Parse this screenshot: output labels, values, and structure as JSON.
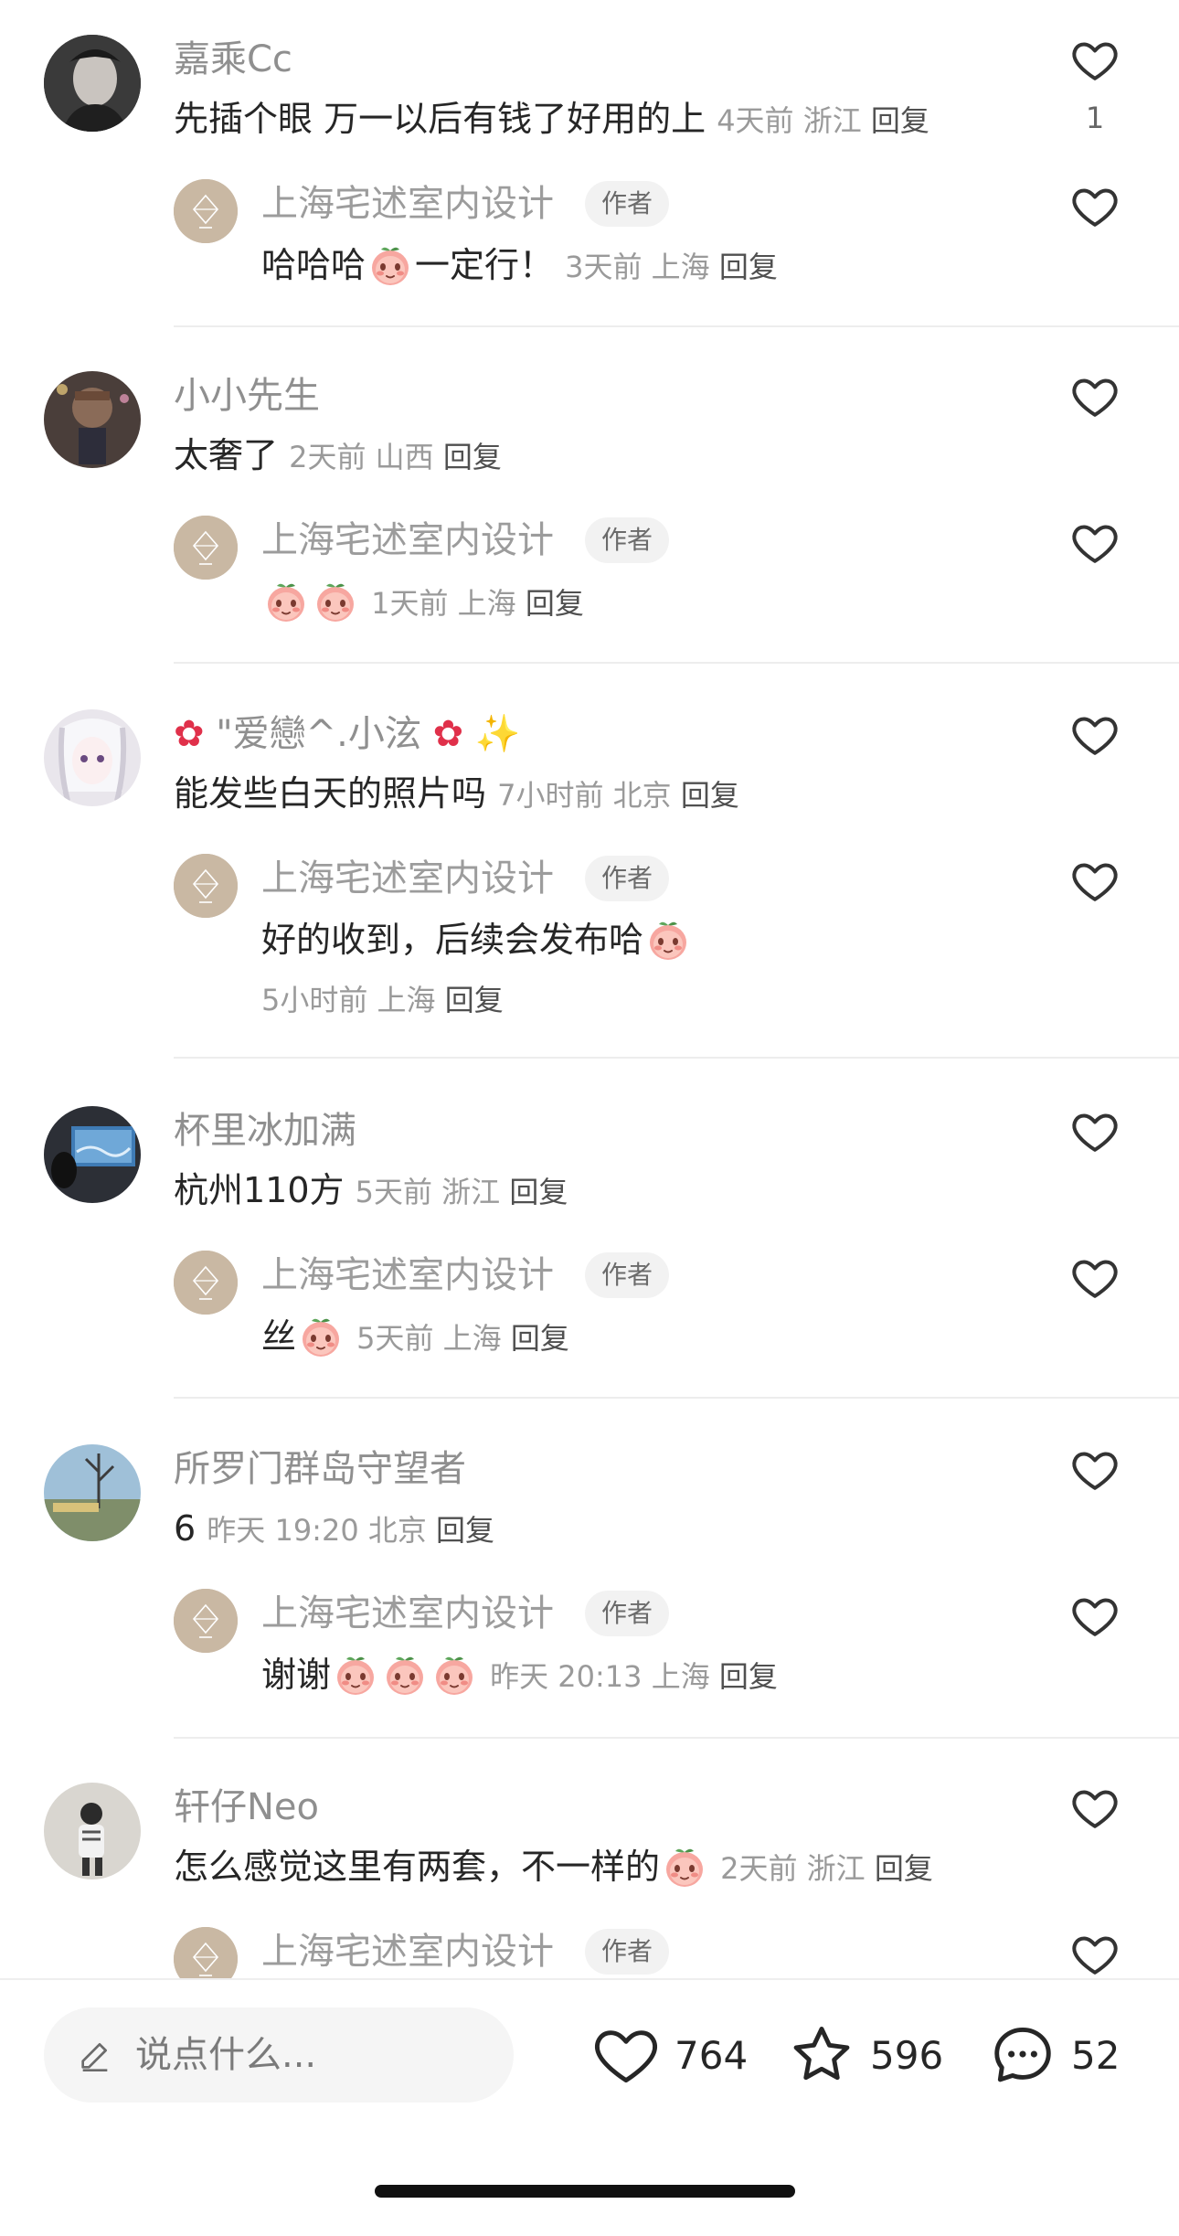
{
  "comments": [
    {
      "user": "嘉乘Cc",
      "text": "先插个眼 万一以后有钱了好用的上",
      "time": "4天前",
      "location": "浙江",
      "reply_label": "回复",
      "like_count": "1",
      "reply": {
        "user": "上海宅述室内设计",
        "badge": "作者",
        "text": "哈哈哈",
        "text_after": "一定行！",
        "time": "3天前",
        "location": "上海",
        "reply_label": "回复"
      }
    },
    {
      "user": "小小先生",
      "text": "太奢了",
      "time": "2天前",
      "location": "山西",
      "reply_label": "回复",
      "reply": {
        "user": "上海宅述室内设计",
        "badge": "作者",
        "time": "1天前",
        "location": "上海",
        "reply_label": "回复"
      }
    },
    {
      "user": "\"爱戀^.小泫",
      "text": "能发些白天的照片吗",
      "time": "7小时前",
      "location": "北京",
      "reply_label": "回复",
      "reply": {
        "user": "上海宅述室内设计",
        "badge": "作者",
        "text": "好的收到，后续会发布哈",
        "time": "5小时前",
        "location": "上海",
        "reply_label": "回复"
      }
    },
    {
      "user": "杯里冰加满",
      "text": "杭州110方",
      "time": "5天前",
      "location": "浙江",
      "reply_label": "回复",
      "reply": {
        "user": "上海宅述室内设计",
        "badge": "作者",
        "text": "丝",
        "time": "5天前",
        "location": "上海",
        "reply_label": "回复"
      }
    },
    {
      "user": "所罗门群岛守望者",
      "text": "6",
      "time": "昨天 19:20",
      "location": "北京",
      "reply_label": "回复",
      "reply": {
        "user": "上海宅述室内设计",
        "badge": "作者",
        "text": "谢谢",
        "time": "昨天 20:13",
        "location": "上海",
        "reply_label": "回复"
      }
    },
    {
      "user": "轩仔Neo",
      "text": "怎么感觉这里有两套，不一样的",
      "time": "2天前",
      "location": "浙江",
      "reply_label": "回复",
      "reply": {
        "user": "上海宅述室内设计",
        "badge": "作者"
      }
    }
  ],
  "bottom_bar": {
    "input_placeholder": "说点什么...",
    "likes": "764",
    "collects": "596",
    "comments": "52"
  },
  "colors": {
    "accent_heart": "#262626",
    "username": "#8f8f8f",
    "meta": "#9a9a9a"
  }
}
